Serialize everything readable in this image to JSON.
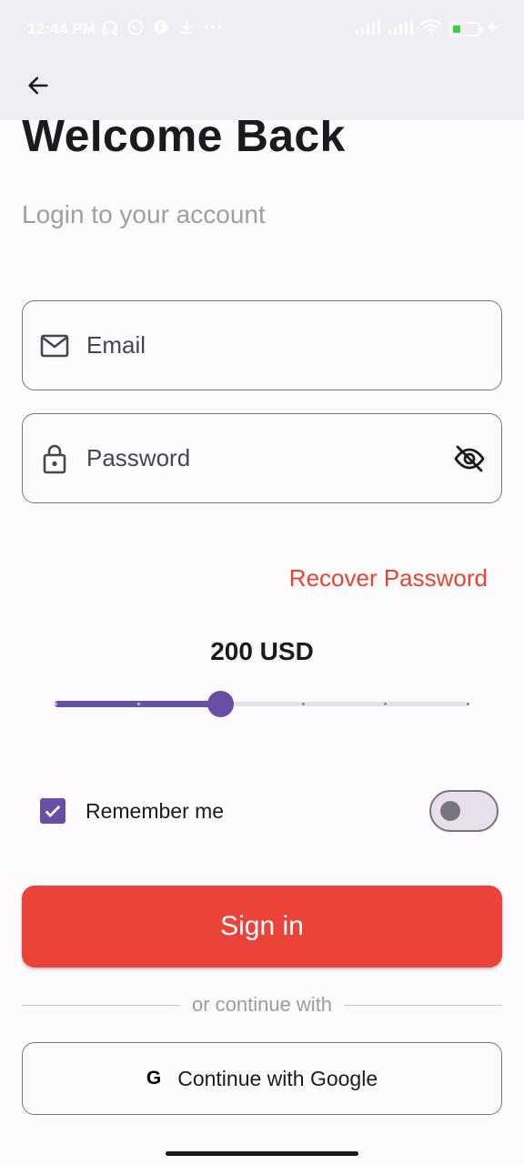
{
  "status_bar": {
    "time": "12:44 PM",
    "left_icons": [
      "headset-icon",
      "whatsapp-icon",
      "app-icon",
      "download-icon",
      "more-dots-icon"
    ],
    "right_icons": [
      "signal-icon",
      "signal-icon",
      "wifi-icon",
      "battery-icon",
      "charging-icon"
    ]
  },
  "app_bar": {
    "back_icon": "arrow-back-icon"
  },
  "header": {
    "title": "Welcome Back",
    "subtitle": "Login to your account"
  },
  "form": {
    "email": {
      "placeholder": "Email",
      "value": "",
      "icon": "mail-icon"
    },
    "password": {
      "placeholder": "Password",
      "value": "",
      "icon": "lock-icon",
      "trailing_icon": "eye-off-icon"
    },
    "recover_label": "Recover Password"
  },
  "amount": {
    "label": "200 USD",
    "slider_fraction": 0.4,
    "tick_count": 6
  },
  "remember": {
    "label": "Remember me",
    "checked": true,
    "toggle_on": false
  },
  "actions": {
    "signin_label": "Sign in",
    "divider_text": "or continue with",
    "google_icon": "G",
    "google_label": "Continue with Google"
  },
  "colors": {
    "primary": "#6750a4",
    "accent_red": "#ea433a",
    "recover_red": "#e8432f",
    "background": "#fefbff",
    "app_bar": "#f0edf4"
  }
}
